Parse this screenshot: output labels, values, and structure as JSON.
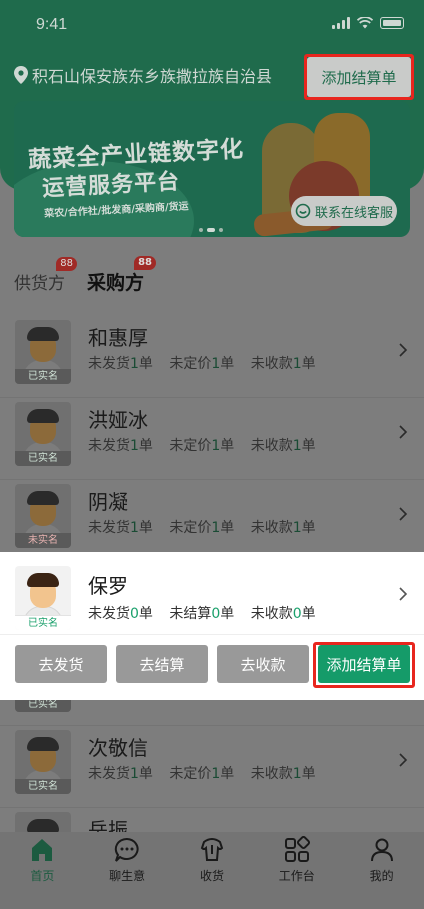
{
  "status_bar": {
    "time": "9:41"
  },
  "header": {
    "location": "积石山保安族东乡族撒拉族自治县",
    "add_button": "添加结算单"
  },
  "banner": {
    "line1": "蔬菜全产业链数字化",
    "line2": "运营服务平台",
    "line3": "菜农/合作社/批发商/采购商/货运",
    "customer_service": "联系在线客服"
  },
  "tabs": [
    {
      "label": "供货方",
      "badge": "88",
      "active": false
    },
    {
      "label": "采购方",
      "badge": "88",
      "active": true
    }
  ],
  "list": [
    {
      "name": "和惠厚",
      "tag": "已实名",
      "stats": [
        {
          "label": "未发货",
          "value": "1",
          "unit": "单"
        },
        {
          "label": "未定价",
          "value": "1",
          "unit": "单"
        },
        {
          "label": "未收款",
          "value": "1",
          "unit": "单"
        }
      ]
    },
    {
      "name": "洪娅冰",
      "tag": "已实名",
      "stats": [
        {
          "label": "未发货",
          "value": "1",
          "unit": "单"
        },
        {
          "label": "未定价",
          "value": "1",
          "unit": "单"
        },
        {
          "label": "未收款",
          "value": "1",
          "unit": "单"
        }
      ]
    },
    {
      "name": "阴凝",
      "tag": "未实名",
      "stats": [
        {
          "label": "未发货",
          "value": "1",
          "unit": "单"
        },
        {
          "label": "未定价",
          "value": "1",
          "unit": "单"
        },
        {
          "label": "未收款",
          "value": "1",
          "unit": "单"
        }
      ]
    },
    {
      "name": "次敬信",
      "tag": "已实名",
      "stats": [
        {
          "label": "未发货",
          "value": "1",
          "unit": "单"
        },
        {
          "label": "未定价",
          "value": "1",
          "unit": "单"
        },
        {
          "label": "未收款",
          "value": "1",
          "unit": "单"
        }
      ]
    },
    {
      "name": "岳振",
      "tag": "",
      "stats": []
    }
  ],
  "popup": {
    "name": "保罗",
    "tag": "已实名",
    "hidden_row_tag": "已实名",
    "stats": [
      {
        "label": "未发货",
        "value": "0",
        "unit": "单"
      },
      {
        "label": "未结算",
        "value": "0",
        "unit": "单"
      },
      {
        "label": "未收款",
        "value": "0",
        "unit": "单"
      }
    ],
    "actions": [
      "去发货",
      "去结算",
      "去收款",
      "添加结算单"
    ]
  },
  "bottom_nav": [
    {
      "label": "首页",
      "icon": "home-icon",
      "active": true
    },
    {
      "label": "聊生意",
      "icon": "chat-icon",
      "active": false
    },
    {
      "label": "收货",
      "icon": "receive-icon",
      "active": false
    },
    {
      "label": "工作台",
      "icon": "workbench-icon",
      "active": false
    },
    {
      "label": "我的",
      "icon": "profile-icon",
      "active": false
    }
  ],
  "colors": {
    "brand": "#1aa06b",
    "highlight": "#e8261e"
  }
}
